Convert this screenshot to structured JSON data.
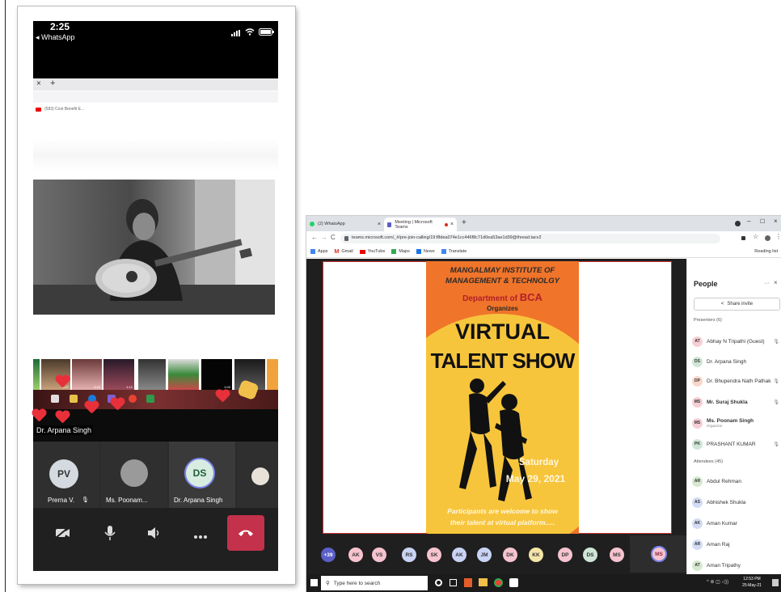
{
  "phone": {
    "status_time": "2:25",
    "back_app": "◂ WhatsApp",
    "tab_close": "×",
    "tab_add": "+",
    "yt_tab": "(583) Cost Benefit E...",
    "stage_label": "Dr. Arpana Singh",
    "participants": [
      {
        "initials": "PV",
        "name": "Prerna V."
      },
      {
        "initials": "",
        "name": "Ms. Poonam..."
      },
      {
        "initials": "DS",
        "name": "Dr. Arpana Singh"
      }
    ],
    "thumb_durations": [
      "1:27",
      "0:20",
      "1:12",
      "1:00"
    ]
  },
  "desktop": {
    "tabs": [
      {
        "label": "(2) WhatsApp"
      },
      {
        "label": "Meeting | Microsoft Teams"
      }
    ],
    "tab_close": "×",
    "tab_add": "+",
    "url": "teams.microsoft.com/_#/pre-join-calling/19:f8dea074e1cc446f8c71d0ea53ae1d39@thread.tacv2",
    "bookmarks": [
      "Apps",
      "Gmail",
      "YouTube",
      "Maps",
      "News",
      "Translate"
    ],
    "reading_list": "Reading list",
    "poster": {
      "line1": "MANGALMAY INSTITUTE OF",
      "line2": "MANAGEMENT & TECHNOLGY",
      "dept_prefix": "Department of",
      "dept_name": "BCA",
      "organizes": "Organizes",
      "title1": "VIRTUAL",
      "title2": "TALENT SHOW",
      "day": "Saturday",
      "date": "May 29, 2021",
      "footer1": "Participants are welcome to show",
      "footer2": "their talent at virtual platform....."
    },
    "people": {
      "title": "People",
      "share": "Share invite",
      "presenters_header": "Presenters (6)",
      "presenters": [
        {
          "initials": "AT",
          "name": "Abhay N Tripathi (Guest)",
          "sub": "",
          "color": "#f6cfd6"
        },
        {
          "initials": "DS",
          "name": "Dr. Arpana Singh",
          "sub": "",
          "color": "#cfe6d6"
        },
        {
          "initials": "DP",
          "name": "Dr. Bhupendra Nath Pathak",
          "sub": "",
          "color": "#f9d7c8"
        },
        {
          "initials": "MS",
          "name": "Mr. Suraj Shukla",
          "sub": "",
          "color": "#f6cfd6"
        },
        {
          "initials": "MS",
          "name": "Ms. Poonam Singh",
          "sub": "Organizer",
          "color": "#f6cfd6"
        },
        {
          "initials": "PK",
          "name": "PRASHANT KUMAR",
          "sub": "",
          "color": "#cfe6d6"
        }
      ],
      "attendees_header": "Attendees (45)",
      "attendees": [
        {
          "initials": "AR",
          "name": "Abdul Rehman",
          "color": "#d6e8d0"
        },
        {
          "initials": "AS",
          "name": "Abhishek Shukla",
          "color": "#d3dcf4"
        },
        {
          "initials": "AK",
          "name": "Aman Kumar",
          "color": "#d3dcf4"
        },
        {
          "initials": "AR",
          "name": "Aman Raj",
          "color": "#d3dcf4"
        },
        {
          "initials": "AT",
          "name": "Aman Tripathy",
          "color": "#d6e8d0"
        }
      ]
    },
    "call_bar": {
      "more": "+39",
      "avatars": [
        {
          "initials": "AK",
          "color": "#f6c3cf"
        },
        {
          "initials": "VS",
          "color": "#f6c3cf"
        },
        {
          "initials": "RS",
          "color": "#c9d3f5"
        },
        {
          "initials": "SK",
          "color": "#f6c3cf"
        },
        {
          "initials": "AK",
          "color": "#c9d3f5"
        },
        {
          "initials": "JM",
          "color": "#c9d3f5"
        },
        {
          "initials": "DK",
          "color": "#f6c3cf"
        },
        {
          "initials": "KK",
          "color": "#f5e6a8"
        },
        {
          "initials": "DP",
          "color": "#f6c3cf"
        },
        {
          "initials": "DS",
          "color": "#cfe6d6"
        },
        {
          "initials": "MS",
          "color": "#f6c3cf"
        }
      ],
      "self": "MS"
    },
    "taskbar": {
      "search": "Type here to search",
      "time": "12:53 PM",
      "date": "25-May-21"
    }
  }
}
